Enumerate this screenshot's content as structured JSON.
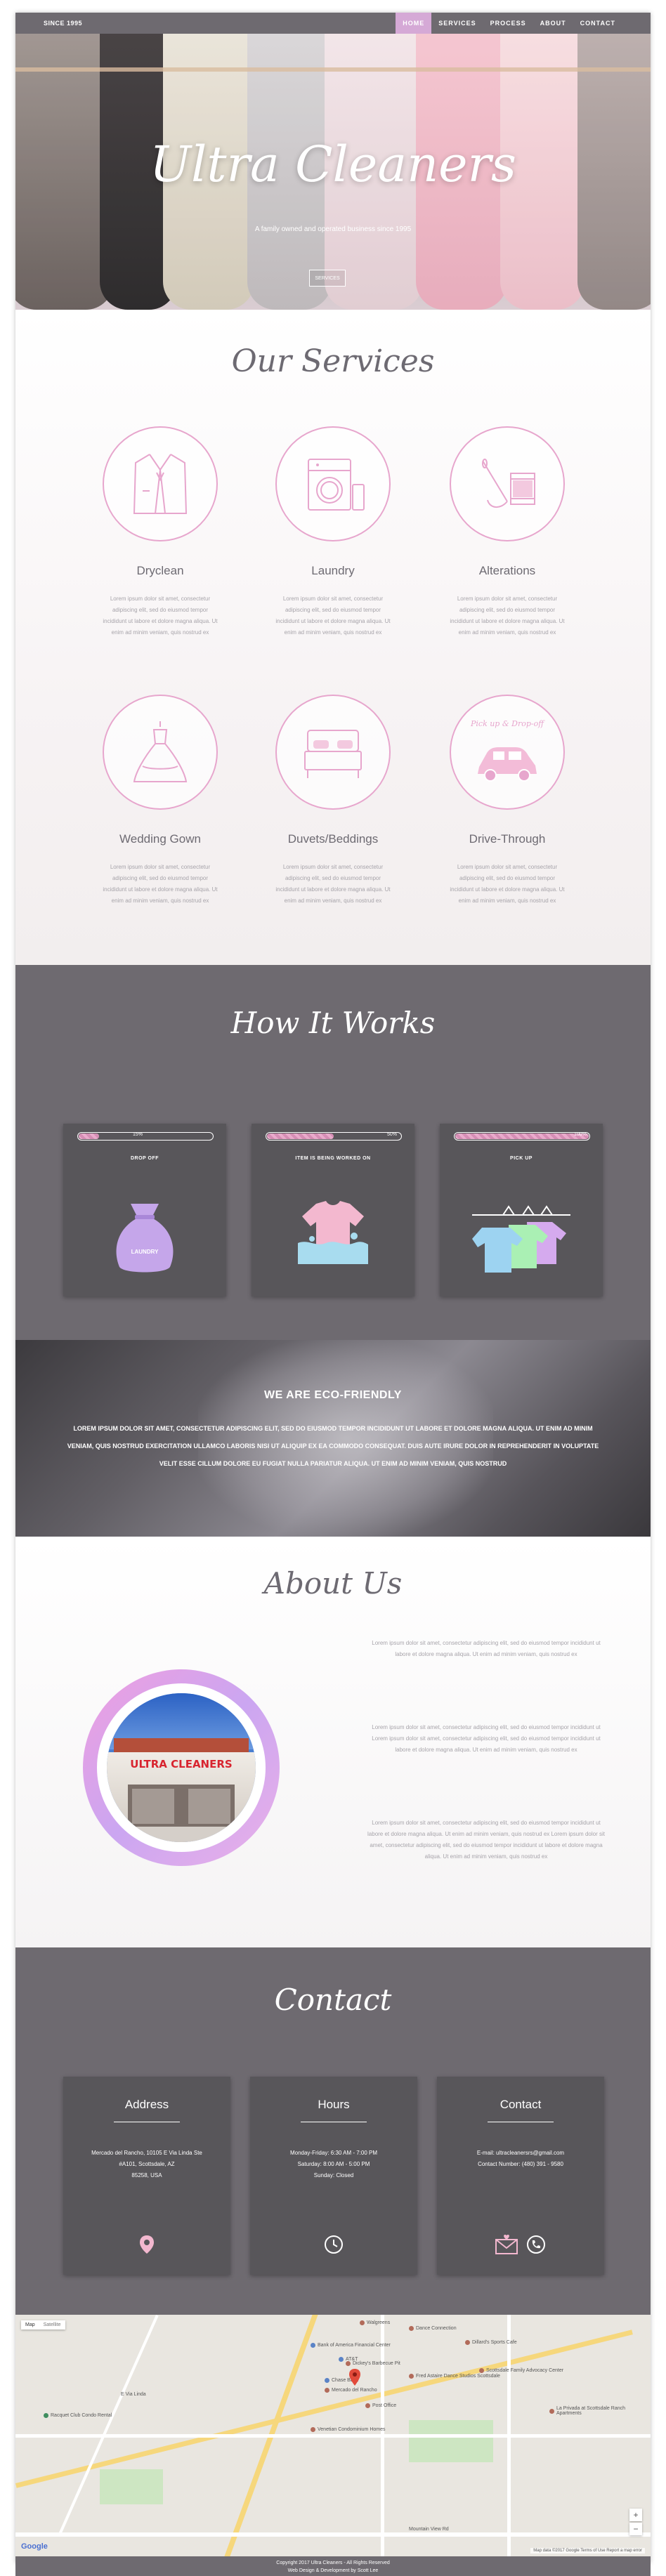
{
  "nav": {
    "since": "SINCE 1995",
    "links": [
      "HOME",
      "SERVICES",
      "PROCESS",
      "ABOUT",
      "CONTACT"
    ]
  },
  "hero": {
    "title": "Ultra Cleaners",
    "tagline": "A family owned and operated business since 1995",
    "button": "SERVICES"
  },
  "services": {
    "title": "Our Services",
    "items": [
      {
        "name": "Dryclean",
        "icon": "suit-icon",
        "desc": "Lorem ipsum dolor sit amet, consectetur adipiscing elit, sed do eiusmod tempor incididunt ut labore et dolore magna aliqua. Ut enim ad minim veniam, quis nostrud ex"
      },
      {
        "name": "Laundry",
        "icon": "washing-machine-icon",
        "desc": "Lorem ipsum dolor sit amet, consectetur adipiscing elit, sed do eiusmod tempor incididunt ut labore et dolore magna aliqua. Ut enim ad minim veniam, quis nostrud ex"
      },
      {
        "name": "Alterations",
        "icon": "needle-thread-icon",
        "desc": "Lorem ipsum dolor sit amet, consectetur adipiscing elit, sed do eiusmod tempor incididunt ut labore et dolore magna aliqua. Ut enim ad minim veniam, quis nostrud ex"
      },
      {
        "name": "Wedding Gown",
        "icon": "wedding-gown-icon",
        "desc": "Lorem ipsum dolor sit amet, consectetur adipiscing elit, sed do eiusmod tempor incididunt ut labore et dolore magna aliqua. Ut enim ad minim veniam, quis nostrud ex"
      },
      {
        "name": "Duvets/Beddings",
        "icon": "bed-icon",
        "desc": "Lorem ipsum dolor sit amet, consectetur adipiscing elit, sed do eiusmod tempor incididunt ut labore et dolore magna aliqua. Ut enim ad minim veniam, quis nostrud ex"
      },
      {
        "name": "Drive-Through",
        "icon": "car-icon",
        "icon_text": "Pick up & Drop-off",
        "desc": "Lorem ipsum dolor sit amet, consectetur adipiscing elit, sed do eiusmod tempor incididunt ut labore et dolore magna aliqua. Ut enim ad minim veniam, quis nostrud ex"
      }
    ]
  },
  "process": {
    "title": "How It Works",
    "steps": [
      {
        "label": "DROP OFF",
        "progress": 0.15,
        "pct": "15%",
        "icon": "laundry-bag-icon",
        "icon_text": "LAUNDRY"
      },
      {
        "label": "ITEM IS BEING WORKED ON",
        "progress": 0.5,
        "pct": "50%",
        "icon": "shirt-washing-icon"
      },
      {
        "label": "PICK UP",
        "progress": 1.0,
        "pct": "100%",
        "icon": "hanging-shirts-icon"
      }
    ]
  },
  "eco": {
    "title": "WE ARE ECO-FRIENDLY",
    "body": "Lorem ipsum dolor sit amet, consectetur adipiscing elit, sed do eiusmod tempor incididunt ut labore et dolore magna aliqua. Ut enim ad minim veniam, quis nostrud exercitation ullamco laboris nisi ut aliquip ex ea commodo consequat. Duis aute irure dolor in reprehenderit in voluptate velit esse cillum dolore eu fugiat nulla pariatur aliqua. Ut enim ad minim veniam, quis nostrud"
  },
  "about": {
    "title": "About Us",
    "photo_sign": "ULTRA CLEANERS",
    "paragraphs": [
      "Lorem ipsum dolor sit amet, consectetur adipiscing elit, sed do eiusmod tempor incididunt ut labore et dolore magna aliqua. Ut enim ad minim veniam, quis nostrud ex",
      "Lorem ipsum dolor sit amet, consectetur adipiscing elit, sed do eiusmod tempor incididunt ut Lorem ipsum dolor sit amet, consectetur adipiscing elit, sed do eiusmod tempor incididunt ut labore et dolore magna aliqua. Ut enim ad minim veniam, quis nostrud ex",
      "Lorem ipsum dolor sit amet, consectetur adipiscing elit, sed do eiusmod tempor incididunt ut labore et dolore magna aliqua. Ut enim ad minim veniam, quis nostrud ex Lorem ipsum dolor sit amet, consectetur adipiscing elit, sed do eiusmod tempor incididunt ut labore et dolore magna aliqua. Ut enim ad minim veniam, quis nostrud ex"
    ]
  },
  "contact": {
    "title": "Contact",
    "cards": [
      {
        "title": "Address",
        "lines": [
          "Mercado del Rancho, 10105 E Via Linda Ste",
          "#A101, Scottsdale, AZ",
          "85258, USA"
        ],
        "icons": [
          "map-pin-icon"
        ]
      },
      {
        "title": "Hours",
        "lines": [
          "Monday-Friday: 6:30 AM - 7:00 PM",
          "Saturday: 8:00 AM - 5:00 PM",
          "Sunday: Closed"
        ],
        "icons": [
          "clock-icon"
        ]
      },
      {
        "title": "Contact",
        "lines": [
          "E-mail: ultracleanersrs@gmail.com",
          "Contact Number: (480) 391 - 9580"
        ],
        "icons": [
          "envelope-icon",
          "phone-icon"
        ]
      }
    ]
  },
  "map": {
    "type_map": "Map",
    "type_sat": "Satellite",
    "logo": "Google",
    "footer": "Map data ©2017 Google   Terms of Use   Report a map error",
    "pois": [
      "Walgreens",
      "Dance Connection",
      "Bank of America Financial Center",
      "Dickey's Barbecue Pit",
      "Chase Bank",
      "Mercado del Rancho",
      "Fred Astaire Dance Studios Scottsdale",
      "Scottsdale Family Advocacy Center",
      "AT&T",
      "Post Office",
      "La Privada at Scottsdale Ranch Apartments",
      "Racquet Club Condo Rental",
      "Venetian Condominium Homes",
      "Dillard's Sports Cafe"
    ],
    "roads": [
      "E Via Linda",
      "Mountain View Rd"
    ]
  },
  "footer": {
    "line1": "Copyright 2017 Ultra Cleaners - All Rights Reserved",
    "line2": "Web Design & Development by Scott Lee"
  },
  "colors": {
    "accent": "#d5a9d6",
    "pink": "#e7a6cd",
    "dark": "#6e6a70",
    "card": "#58565a"
  }
}
